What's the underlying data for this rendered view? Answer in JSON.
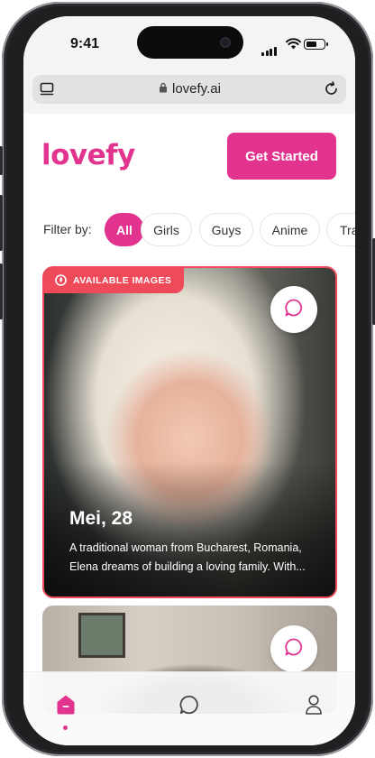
{
  "status_bar": {
    "time": "9:41"
  },
  "browser": {
    "url": "lovefy.ai"
  },
  "header": {
    "logo": "lovefy",
    "cta_label": "Get Started"
  },
  "filter": {
    "label": "Filter by:",
    "options": [
      "All",
      "Girls",
      "Guys",
      "Anime",
      "Tra"
    ],
    "selected": "All"
  },
  "cards": [
    {
      "badge": "AVAILABLE IMAGES",
      "name": "Mei, 28",
      "description_line1": "A traditional woman from Bucharest, Romania,",
      "description_line2": "Elena dreams of building a loving family. With..."
    },
    {
      "partial": true
    }
  ],
  "bottom_nav": {
    "items": [
      "home-icon",
      "chat-icon",
      "profile-icon"
    ],
    "active": "home-icon"
  },
  "colors": {
    "brand": "#e2338f",
    "badge": "#ef4a5a"
  }
}
